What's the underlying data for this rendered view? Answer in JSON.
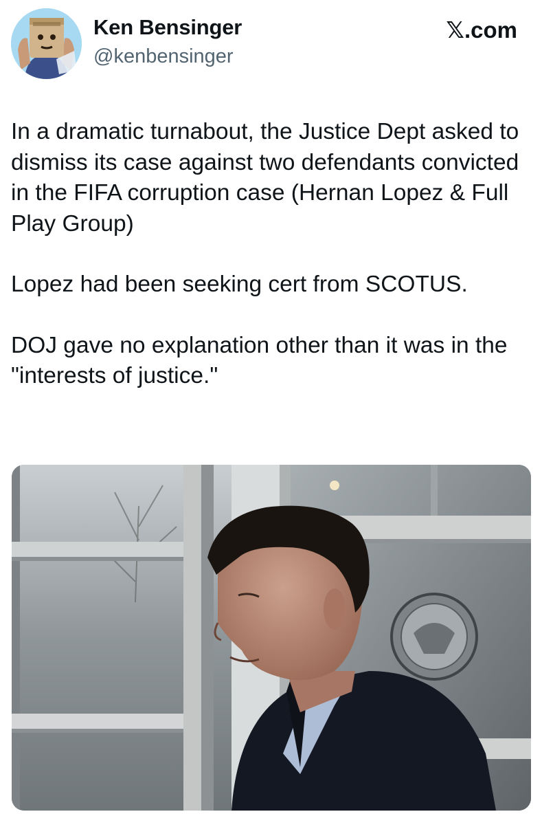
{
  "author": {
    "display_name": "Ken Bensinger",
    "handle": "@kenbensinger",
    "avatar_icon": "paper-bag-head-avatar-icon"
  },
  "source": {
    "site_label": "𝕏.com"
  },
  "tweet": {
    "paragraphs": [
      "In a dramatic turnabout, the Justice Dept asked to dismiss its case against two defendants convicted in the FIFA corruption case (Hernan Lopez & Full Play Group)",
      "Lopez had been seeking cert from SCOTUS.",
      "DOJ gave no explanation other than it was in the \"interests of justice.\""
    ]
  },
  "media": {
    "icon": "man-exiting-courthouse-photo",
    "colors": {
      "suit": "#141823",
      "shirt": "#aebdd6",
      "hair": "#1a1410",
      "skin": "#b98470",
      "door_frame": "#c7c9c9",
      "glass": "#8a9196"
    }
  }
}
